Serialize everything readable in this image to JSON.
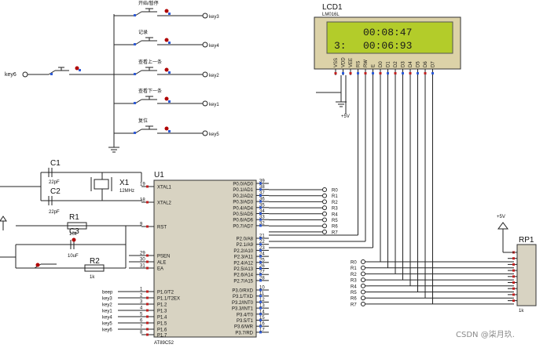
{
  "lcd": {
    "ref": "LCD1",
    "model": "LM016L",
    "line1": "00:08:47",
    "line2_prefix": "3:",
    "line2": "00:06:93",
    "pins": [
      "VSS",
      "VDD",
      "VEE",
      "RS",
      "RW",
      "E",
      "D0",
      "D1",
      "D2",
      "D3",
      "D4",
      "D5",
      "D6",
      "D7"
    ],
    "pin_numbers": [
      "1",
      "2",
      "3",
      "4",
      "5",
      "6",
      "7",
      "8",
      "9",
      "10",
      "11",
      "12",
      "13",
      "14"
    ]
  },
  "buttons": [
    {
      "label": "开始/暂停",
      "net": "key3"
    },
    {
      "label": "记录",
      "net": "key4"
    },
    {
      "label": "查看上一条",
      "net": "key2"
    },
    {
      "label": "查看下一条",
      "net": "key1"
    },
    {
      "label": "复位",
      "net": "key5"
    }
  ],
  "key6": {
    "net": "key6"
  },
  "mcu": {
    "ref": "U1",
    "part": "AT89C52",
    "left_pins": [
      {
        "name": "XTAL1",
        "num": "19"
      },
      {
        "name": "XTAL2",
        "num": "18"
      },
      {
        "name": "RST",
        "num": "9"
      },
      {
        "name": "PSEN",
        "num": "29"
      },
      {
        "name": "ALE",
        "num": "30"
      },
      {
        "name": "EA",
        "num": "31"
      },
      {
        "name": "P1.0/T2",
        "num": "1"
      },
      {
        "name": "P1.1/T2EX",
        "num": "2"
      },
      {
        "name": "P1.2",
        "num": "3"
      },
      {
        "name": "P1.3",
        "num": "4"
      },
      {
        "name": "P1.4",
        "num": "5"
      },
      {
        "name": "P1.5",
        "num": "6"
      },
      {
        "name": "P1.6",
        "num": "7"
      },
      {
        "name": "P1.7",
        "num": "8"
      }
    ],
    "right_pins": [
      {
        "name": "P0.0/AD0",
        "num": "39"
      },
      {
        "name": "P0.1/AD1",
        "num": "38"
      },
      {
        "name": "P0.2/AD2",
        "num": "37"
      },
      {
        "name": "P0.3/AD3",
        "num": "36"
      },
      {
        "name": "P0.4/AD4",
        "num": "35"
      },
      {
        "name": "P0.5/AD5",
        "num": "34"
      },
      {
        "name": "P0.6/AD6",
        "num": "33"
      },
      {
        "name": "P0.7/AD7",
        "num": "32"
      },
      {
        "name": "P2.0/A8",
        "num": "21"
      },
      {
        "name": "P2.1/A9",
        "num": "22"
      },
      {
        "name": "P2.2/A10",
        "num": "23"
      },
      {
        "name": "P2.3/A11",
        "num": "24"
      },
      {
        "name": "P2.4/A12",
        "num": "25"
      },
      {
        "name": "P2.5/A13",
        "num": "26"
      },
      {
        "name": "P2.6/A14",
        "num": "27"
      },
      {
        "name": "P2.7/A15",
        "num": "28"
      },
      {
        "name": "P3.0/RXD",
        "num": "10"
      },
      {
        "name": "P3.1/TXD",
        "num": "11"
      },
      {
        "name": "P3.2/INT0",
        "num": "12"
      },
      {
        "name": "P3.3/INT1",
        "num": "13"
      },
      {
        "name": "P3.4/T0",
        "num": "14"
      },
      {
        "name": "P3.5/T1",
        "num": "15"
      },
      {
        "name": "P3.6/WR",
        "num": "16"
      },
      {
        "name": "P3.7/RD",
        "num": "17"
      }
    ],
    "p1_nets": [
      "beep",
      "key3",
      "key2",
      "key1",
      "key4",
      "key5",
      "key6"
    ]
  },
  "r_nets": [
    "R0",
    "R1",
    "R2",
    "R3",
    "R4",
    "R5",
    "R6",
    "R7"
  ],
  "components": {
    "c1": {
      "ref": "C1",
      "value": "22pF"
    },
    "c2": {
      "ref": "C2",
      "value": "22pF"
    },
    "x1": {
      "ref": "X1",
      "value": "12MHz"
    },
    "r1": {
      "ref": "R1",
      "value": "10k"
    },
    "c3": {
      "ref": "C3",
      "value": "10uF"
    },
    "r2": {
      "ref": "R2",
      "value": "1k"
    },
    "rp1": {
      "ref": "RP1",
      "value": "1k"
    }
  },
  "power": {
    "lcd_vdd": "+5V",
    "rp_vcc": "+5V"
  },
  "watermark": "CSDN @柒月玖."
}
